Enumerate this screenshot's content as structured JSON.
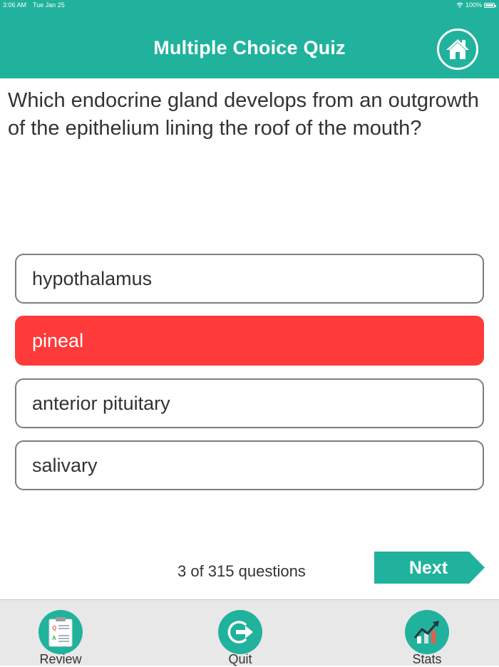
{
  "status_bar": {
    "time": "3:06 AM",
    "date": "Tue Jan 25",
    "battery": "100%"
  },
  "header": {
    "title": "Multiple Choice Quiz",
    "home_icon": "home-icon"
  },
  "question": {
    "text": "Which endocrine gland develops from an outgrowth of the epithelium lining the roof of the mouth?"
  },
  "options": [
    {
      "label": "hypothalamus",
      "state": "default"
    },
    {
      "label": "pineal",
      "state": "wrong"
    },
    {
      "label": "anterior pituitary",
      "state": "default"
    },
    {
      "label": "salivary",
      "state": "default"
    }
  ],
  "progress": {
    "text": "3 of 315 questions"
  },
  "next_button": {
    "label": "Next"
  },
  "tabs": [
    {
      "label": "Review",
      "icon": "clipboard-icon"
    },
    {
      "label": "Quit",
      "icon": "exit-icon"
    },
    {
      "label": "Stats",
      "icon": "chart-icon"
    }
  ],
  "colors": {
    "primary": "#20b29c",
    "wrong": "#fe3a3a",
    "tab_bar": "#e8e8e8"
  }
}
